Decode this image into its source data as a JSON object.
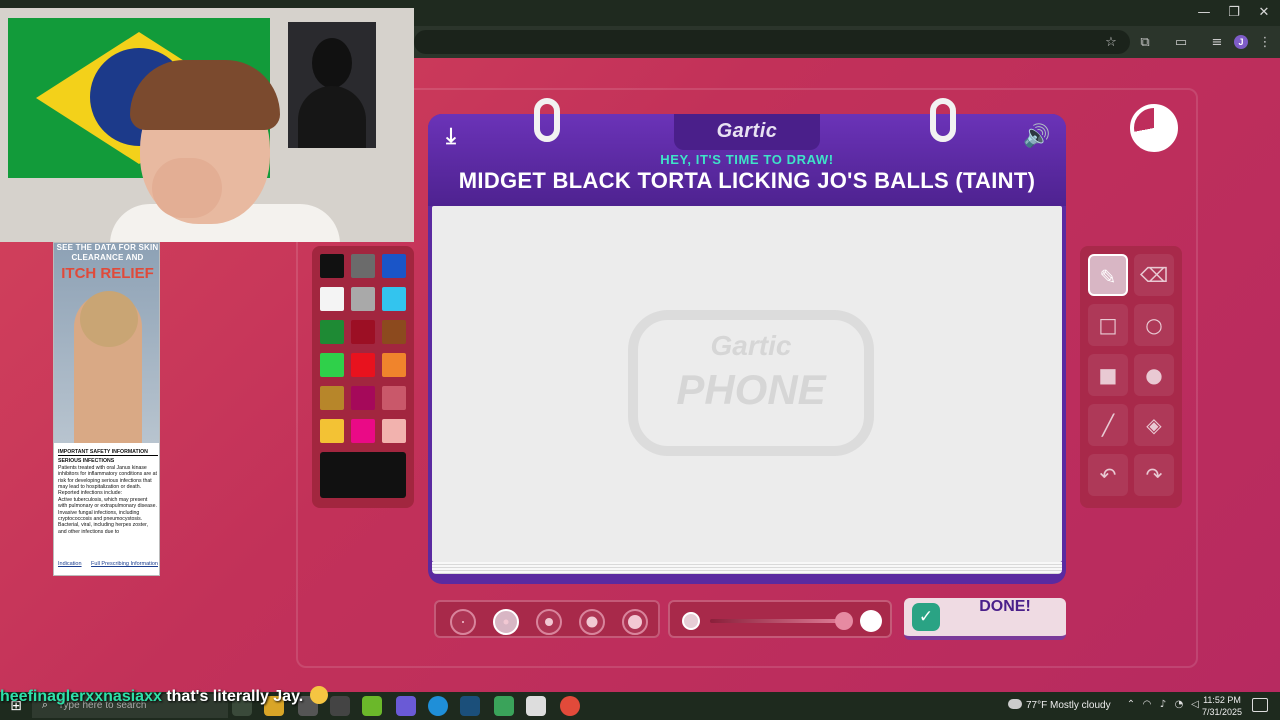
{
  "window": {
    "minimize": "—",
    "restore": "❐",
    "close": "✕"
  },
  "browser": {
    "profile_initial": "J"
  },
  "ad": {
    "headline_1": "SEE THE DATA FOR SKIN CLEARANCE AND",
    "headline_2": "ITCH RELIEF",
    "safety_heading": "IMPORTANT SAFETY INFORMATION",
    "section": "SERIOUS INFECTIONS",
    "body": "Patients treated with oral Janus kinase inhibitors for inflammatory conditions are at risk for developing serious infections that may lead to hospitalization or death. Reported infections include:",
    "bullets": [
      "Active tuberculosis, which may present with pulmonary or extrapulmonary disease.",
      "Invasive fungal infections, including cryptococcosis and pneumocystosis.",
      "Bacterial, viral, including herpes zoster, and other infections due to"
    ],
    "link_indication": "Indication",
    "link_prescribing": "Full Prescribing Information"
  },
  "palette": {
    "colors": [
      "#111111",
      "#6b6b6b",
      "#1a55c8",
      "#f4f4f4",
      "#a9a9a9",
      "#33c4ee",
      "#1e8a34",
      "#9c0f24",
      "#8c4a1e",
      "#2fd04a",
      "#e8121e",
      "#f0842c",
      "#b7862a",
      "#a5095a",
      "#c9586a",
      "#f3c234",
      "#ea0a86",
      "#f2b2ae"
    ],
    "current": "#111111"
  },
  "game": {
    "logo": "Gartic",
    "prompt_label": "HEY, IT'S TIME TO DRAW!",
    "prompt": "MIDGET BLACK TORTA LICKING JO'S BALLS (TAINT)",
    "watermark_1": "Gartic",
    "watermark_2": "PHONE",
    "timer_remaining": 0.72,
    "done_label": "DONE!"
  },
  "tools": [
    {
      "name": "pencil",
      "glyph": "✎",
      "active": true
    },
    {
      "name": "eraser",
      "glyph": "⌫",
      "active": false
    },
    {
      "name": "rectangle-outline",
      "glyph": "□",
      "active": false
    },
    {
      "name": "ellipse-outline",
      "glyph": "○",
      "active": false
    },
    {
      "name": "rectangle-fill",
      "glyph": "■",
      "active": false
    },
    {
      "name": "ellipse-fill",
      "glyph": "●",
      "active": false
    },
    {
      "name": "line",
      "glyph": "╱",
      "active": false
    },
    {
      "name": "fill-bucket",
      "glyph": "◈",
      "active": false
    },
    {
      "name": "undo",
      "glyph": "↶",
      "active": false
    },
    {
      "name": "redo",
      "glyph": "↷",
      "active": false
    }
  ],
  "brush_sizes": {
    "count": 5,
    "selected_index": 1
  },
  "chat": {
    "user": "heefinaglerxxnasiaxx",
    "message": "that's literally Jay."
  },
  "taskbar": {
    "search_placeholder": "Type here to search",
    "weather": "77°F  Mostly cloudy",
    "time": "11:52 PM",
    "date": "7/31/2025"
  }
}
